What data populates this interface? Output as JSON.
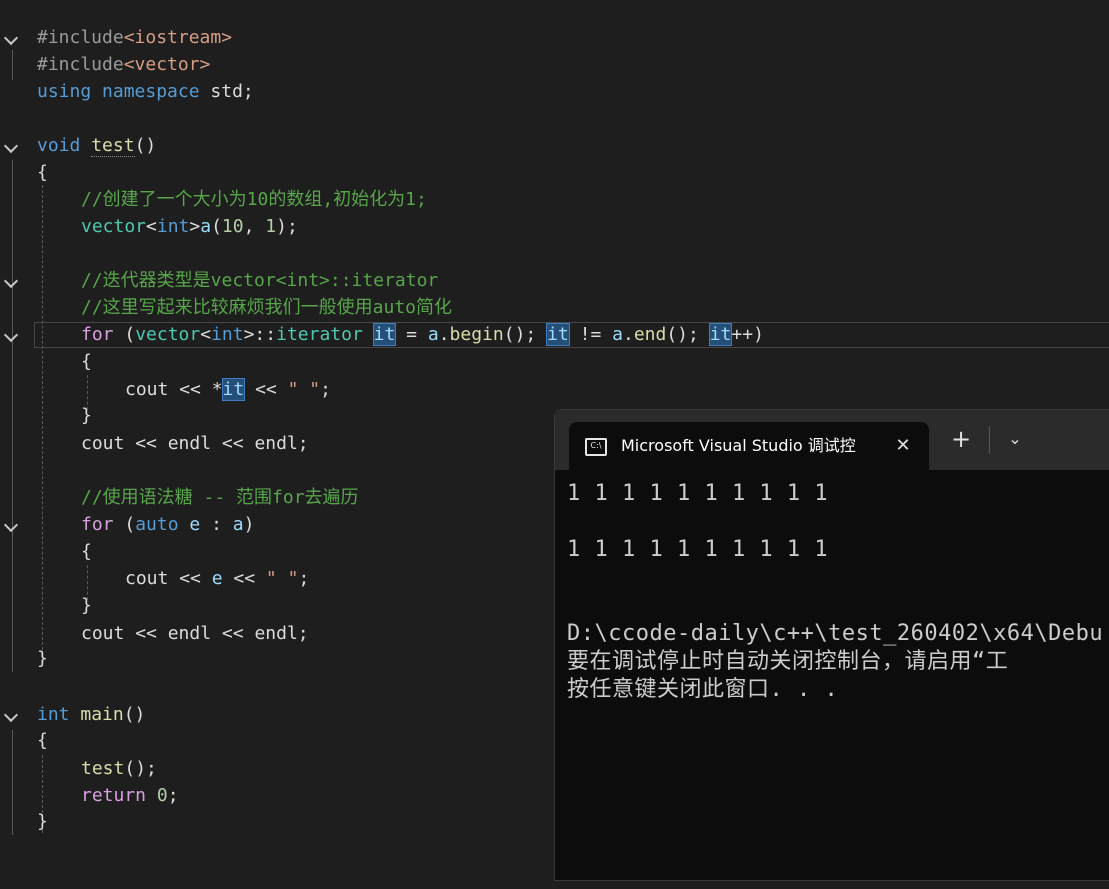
{
  "editor": {
    "lines": {
      "l1": {
        "pp": "#include",
        "inc": "<iostream>"
      },
      "l2": {
        "pp": "#include",
        "inc": "<vector>"
      },
      "l3": {
        "kw1": "using",
        "kw2": "namespace",
        "rest": " std;"
      },
      "l5": {
        "kw": "void",
        "fn": "test",
        "rest": "()"
      },
      "l6": {
        "text": "{"
      },
      "l7": {
        "comment": "//创建了一个大小为10的数组,初始化为1;"
      },
      "l8": {
        "ty": "vector",
        "p1": "<",
        "kw": "int",
        "p2": ">",
        "var": "a",
        "p3": "(",
        "n1": "10",
        "p4": ", ",
        "n2": "1",
        "p5": ");"
      },
      "l10": {
        "comment": "//迭代器类型是vector<int>::iterator"
      },
      "l11": {
        "comment": "//这里写起来比较麻烦我们一般使用auto简化"
      },
      "l12": {
        "ctl": "for",
        "p1": " (",
        "ty": "vector",
        "p2": "<",
        "kw": "int",
        "p3": ">::",
        "ty2": "iterator",
        "sp": " ",
        "it1": "it",
        "p4": " = ",
        "a1": "a",
        "p5": ".",
        "f1": "begin",
        "p6": "(); ",
        "it2": "it",
        "p7": " != ",
        "a2": "a",
        "p8": ".",
        "f2": "end",
        "p9": "(); ",
        "it3": "it",
        "p10": "++)"
      },
      "l13": {
        "text": "{"
      },
      "l14": {
        "var": "cout",
        "p1": " << *",
        "it": "it",
        "p2": " << ",
        "str": "\" \"",
        "p3": ";"
      },
      "l15": {
        "text": "}"
      },
      "l16": {
        "v1": "cout",
        "p1": " << ",
        "v2": "endl",
        "p2": " << ",
        "v3": "endl",
        "p3": ";"
      },
      "l18": {
        "comment": "//使用语法糖 -- 范围for去遍历"
      },
      "l19": {
        "ctl": "for",
        "p1": " (",
        "kw": "auto",
        "sp": " ",
        "v1": "e",
        "p2": " : ",
        "v2": "a",
        "p3": ")"
      },
      "l20": {
        "text": "{"
      },
      "l21": {
        "var": "cout",
        "p1": " << ",
        "v2": "e",
        "p2": " << ",
        "str": "\" \"",
        "p3": ";"
      },
      "l22": {
        "text": "}"
      },
      "l23": {
        "v1": "cout",
        "p1": " << ",
        "v2": "endl",
        "p2": " << ",
        "v3": "endl",
        "p3": ";"
      },
      "l24": {
        "text": "}"
      },
      "l26": {
        "kw": "int",
        "fn": "main",
        "rest": "()"
      },
      "l27": {
        "text": "{"
      },
      "l28": {
        "fn": "test",
        "rest": "();"
      },
      "l29": {
        "ctl": "return",
        "sp": " ",
        "num": "0",
        "rest": ";"
      },
      "l30": {
        "text": "}"
      }
    }
  },
  "terminal": {
    "tab_icon": "C:\\",
    "tab_title": "Microsoft Visual Studio 调试控",
    "tab_close": "✕",
    "new_tab": "+",
    "dropdown": "⌄",
    "output": [
      "1 1 1 1 1 1 1 1 1 1",
      "",
      "1 1 1 1 1 1 1 1 1 1",
      "",
      "",
      "D:\\ccode-daily\\c++\\test_260402\\x64\\Debu",
      "要在调试停止时自动关闭控制台，请启用“工",
      "按任意键关闭此窗口. . ."
    ]
  },
  "colors": {
    "editor_bg": "#1e1e1e",
    "keyword": "#569cd6",
    "comment": "#57a64a",
    "type": "#4ec9b0",
    "function": "#dcdcaa",
    "terminal_bg": "#0c0c0c"
  }
}
